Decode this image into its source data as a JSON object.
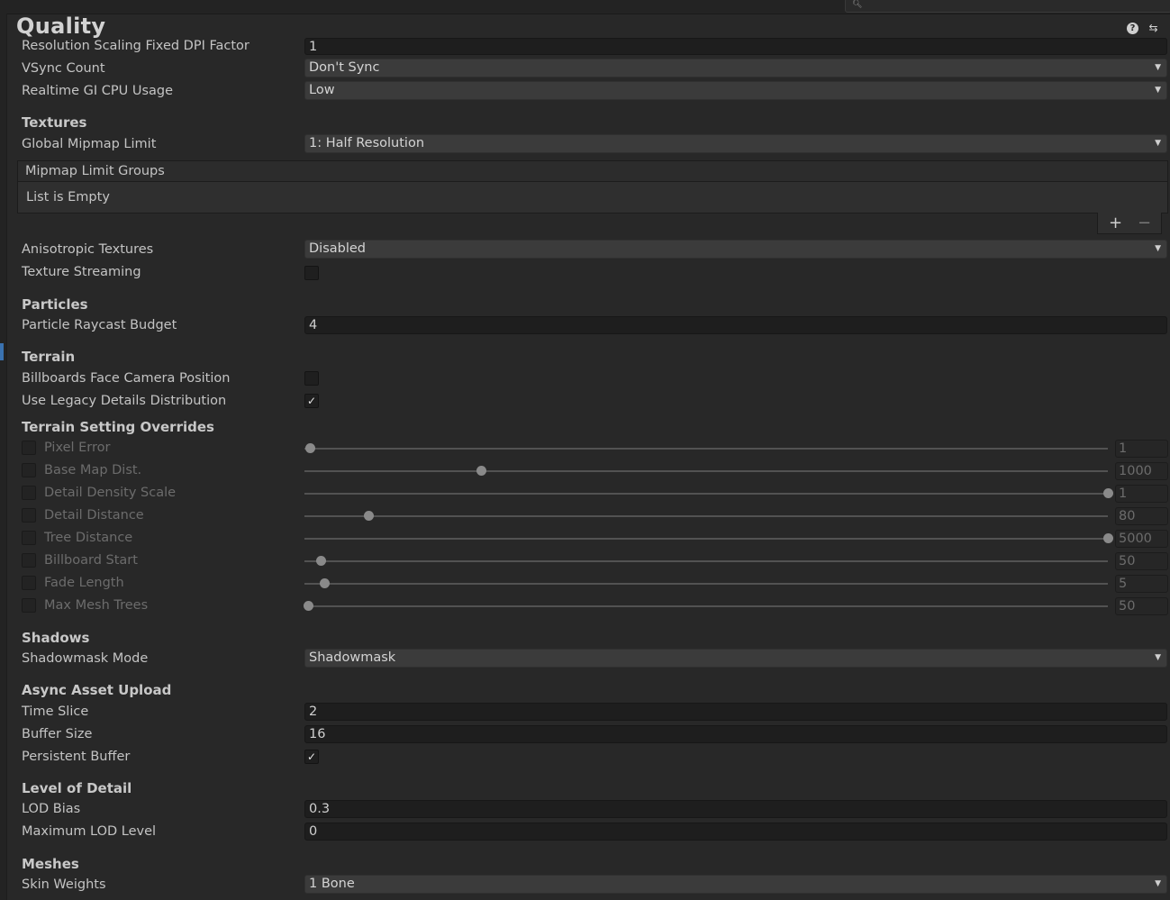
{
  "header": {
    "title": "Quality",
    "search": {
      "placeholder": "",
      "icon": "search-icon"
    },
    "icons": [
      "help-icon",
      "presets-icon"
    ]
  },
  "general": {
    "resolution_scaling": {
      "label": "Resolution Scaling Fixed DPI Factor",
      "value": "1"
    },
    "vsync": {
      "label": "VSync Count",
      "value": "Don't Sync"
    },
    "realtime_gi": {
      "label": "Realtime GI CPU Usage",
      "value": "Low"
    }
  },
  "textures": {
    "heading": "Textures",
    "global_mipmap": {
      "label": "Global Mipmap Limit",
      "value": "1: Half Resolution"
    },
    "mipmap_groups": {
      "header": "Mipmap Limit Groups",
      "empty_text": "List is Empty",
      "add_label": "+",
      "remove_label": "−"
    },
    "anisotropic": {
      "label": "Anisotropic Textures",
      "value": "Disabled"
    },
    "streaming": {
      "label": "Texture Streaming",
      "checked": false
    }
  },
  "particles": {
    "heading": "Particles",
    "raycast_budget": {
      "label": "Particle Raycast Budget",
      "value": "4"
    }
  },
  "terrain": {
    "heading": "Terrain",
    "billboards_face_camera": {
      "label": "Billboards Face Camera Position",
      "checked": false
    },
    "legacy_details": {
      "label": "Use Legacy Details Distribution",
      "checked": true
    }
  },
  "terrain_overrides": {
    "heading": "Terrain Setting Overrides",
    "items": [
      {
        "label": "Pixel Error",
        "value": "1",
        "fraction": 0.0
      },
      {
        "label": "Base Map Dist.",
        "value": "1000",
        "fraction": 0.22
      },
      {
        "label": "Detail Density Scale",
        "value": "1",
        "fraction": 1.0
      },
      {
        "label": "Detail Distance",
        "value": "80",
        "fraction": 0.08
      },
      {
        "label": "Tree Distance",
        "value": "5000",
        "fraction": 1.0
      },
      {
        "label": "Billboard Start",
        "value": "50",
        "fraction": 0.02
      },
      {
        "label": "Fade Length",
        "value": "5",
        "fraction": 0.025
      },
      {
        "label": "Max Mesh Trees",
        "value": "50",
        "fraction": 0.005
      }
    ]
  },
  "shadows": {
    "heading": "Shadows",
    "shadowmask_mode": {
      "label": "Shadowmask Mode",
      "value": "Shadowmask"
    }
  },
  "async_upload": {
    "heading": "Async Asset Upload",
    "time_slice": {
      "label": "Time Slice",
      "value": "2"
    },
    "buffer_size": {
      "label": "Buffer Size",
      "value": "16"
    },
    "persistent_buffer": {
      "label": "Persistent Buffer",
      "checked": true
    }
  },
  "lod": {
    "heading": "Level of Detail",
    "lod_bias": {
      "label": "LOD Bias",
      "value": "0.3"
    },
    "max_lod": {
      "label": "Maximum LOD Level",
      "value": "0"
    }
  },
  "meshes": {
    "heading": "Meshes",
    "skin_weights": {
      "label": "Skin Weights",
      "value": "1 Bone"
    }
  }
}
